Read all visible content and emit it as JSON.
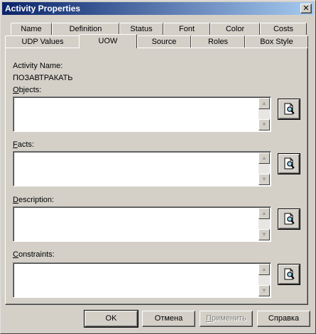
{
  "window": {
    "title": "Activity Properties",
    "close_label": "✕"
  },
  "tabs_back": [
    {
      "label": "Name"
    },
    {
      "label": "Definition"
    },
    {
      "label": "Status"
    },
    {
      "label": "Font"
    },
    {
      "label": "Color"
    },
    {
      "label": "Costs"
    }
  ],
  "tabs_front": [
    {
      "label": "UDP Values"
    },
    {
      "label": "UOW",
      "active": true
    },
    {
      "label": "Source"
    },
    {
      "label": "Roles"
    },
    {
      "label": "Box Style"
    }
  ],
  "activity": {
    "name_label": "Activity Name:",
    "name_value": "ПОЗАВТРАКАТЬ"
  },
  "fields": {
    "objects": {
      "label_hotkey": "O",
      "label_rest": "bjects:",
      "value": ""
    },
    "facts": {
      "label_hotkey": "F",
      "label_rest": "acts:",
      "value": ""
    },
    "description": {
      "label_hotkey": "D",
      "label_rest": "escription:",
      "value": ""
    },
    "constraints": {
      "label_hotkey": "C",
      "label_rest": "onstraints:",
      "value": ""
    }
  },
  "scroll": {
    "up": "▲",
    "down": "▼"
  },
  "buttons": {
    "ok": "OK",
    "cancel": "Отмена",
    "apply_hotkey": "П",
    "apply_rest": "рименить",
    "help": "Справка"
  }
}
